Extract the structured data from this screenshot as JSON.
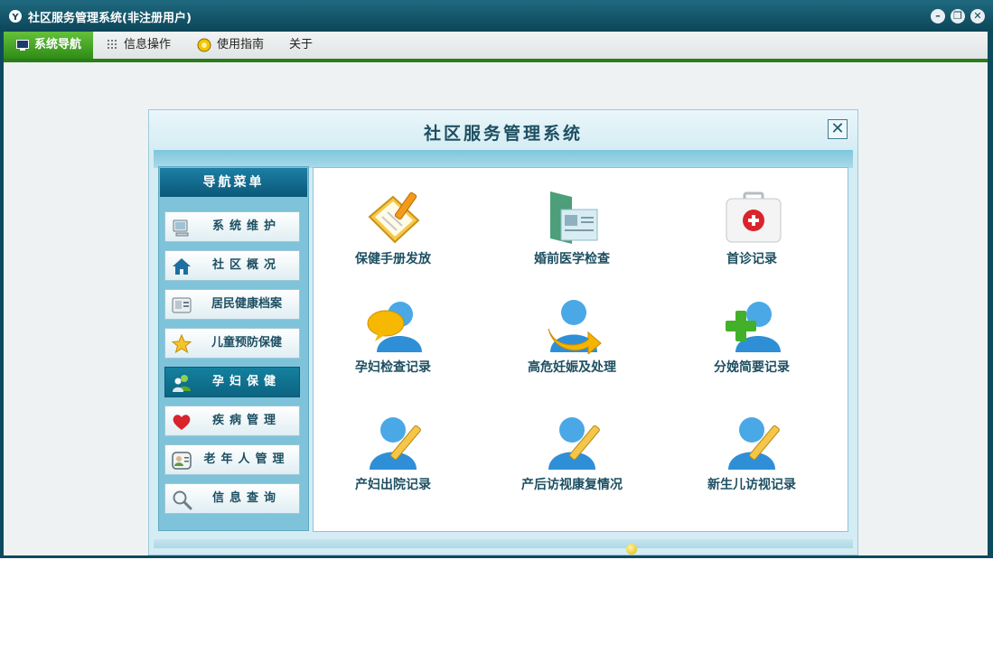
{
  "window": {
    "title": "社区服务管理系统(非注册用户)",
    "icon": "app-logo-icon",
    "controls": [
      "minimize-icon",
      "restore-icon",
      "close-icon"
    ]
  },
  "menubar": {
    "items": [
      {
        "label": "系统导航",
        "icon": "monitor-icon",
        "active": true
      },
      {
        "label": "信息操作",
        "icon": "grid-icon",
        "active": false
      },
      {
        "label": "使用指南",
        "icon": "help-icon",
        "active": false
      },
      {
        "label": "关于",
        "icon": "",
        "active": false
      }
    ]
  },
  "dialog": {
    "title": "社区服务管理系统",
    "close_glyph": "✕"
  },
  "nav": {
    "header": "导航菜单",
    "items": [
      {
        "label": "系统维护",
        "icon": "computer-icon",
        "selected": false
      },
      {
        "label": "社区概况",
        "icon": "home-icon",
        "selected": false
      },
      {
        "label": "居民健康档案",
        "icon": "id-card-icon",
        "selected": false
      },
      {
        "label": "儿童预防保健",
        "icon": "star-icon",
        "selected": false
      },
      {
        "label": "孕妇保健",
        "icon": "users-icon",
        "selected": true
      },
      {
        "label": "疾病管理",
        "icon": "heart-icon",
        "selected": false
      },
      {
        "label": "老年人管理",
        "icon": "contact-icon",
        "selected": false
      },
      {
        "label": "信息查询",
        "icon": "magnifier-icon",
        "selected": false
      }
    ]
  },
  "tiles": [
    {
      "label": "保健手册发放",
      "icon": "notebook-pencil-icon"
    },
    {
      "label": "婚前医学检查",
      "icon": "folder-document-icon"
    },
    {
      "label": "首诊记录",
      "icon": "first-aid-kit-icon"
    },
    {
      "label": "孕妇检查记录",
      "icon": "user-chat-icon"
    },
    {
      "label": "高危妊娠及处理",
      "icon": "user-arrow-icon"
    },
    {
      "label": "分娩简要记录",
      "icon": "user-add-icon"
    },
    {
      "label": "产妇出院记录",
      "icon": "user-edit-icon"
    },
    {
      "label": "产后访视康复情况",
      "icon": "user-edit-icon"
    },
    {
      "label": "新生儿访视记录",
      "icon": "user-edit-icon"
    }
  ],
  "colors": {
    "titlebar": "#0c4558",
    "active_menu": "#3a9a1f",
    "nav_selected": "#0b6481",
    "label_text": "#1d4f62"
  }
}
